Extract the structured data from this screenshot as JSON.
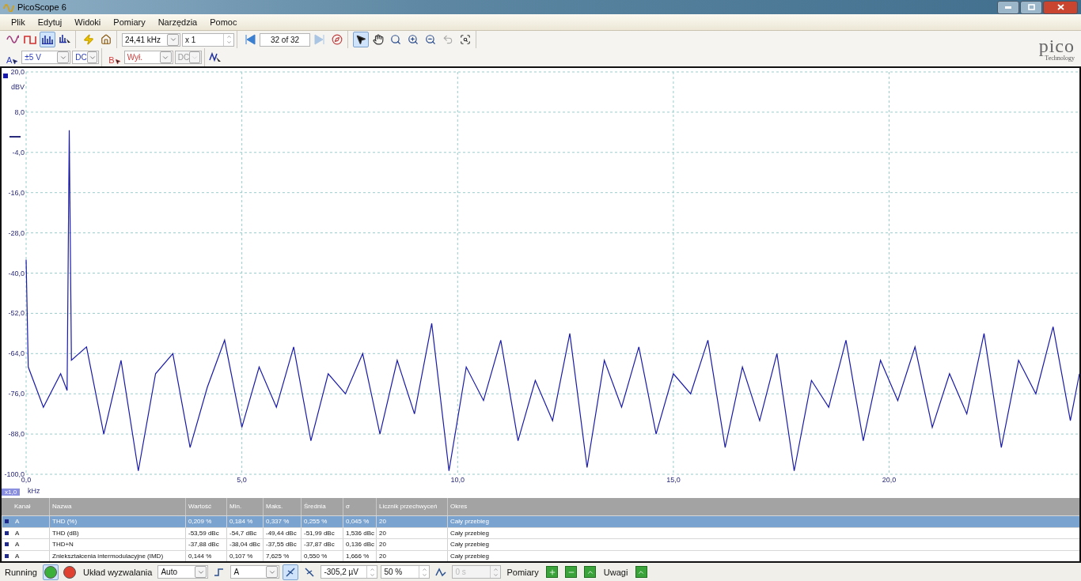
{
  "window": {
    "title": "PicoScope 6"
  },
  "menu": [
    "Plik",
    "Edytuj",
    "Widoki",
    "Pomiary",
    "Narzędzia",
    "Pomoc"
  ],
  "toolbar": {
    "view_modes": [
      {
        "kind": "scope",
        "selected": false
      },
      {
        "kind": "persistence",
        "selected": false
      },
      {
        "kind": "spectrum",
        "selected": true
      },
      {
        "kind": "spectrum-options",
        "selected": false
      }
    ],
    "timebase": "24,41 kHz",
    "multiplier": "x 1",
    "buffer": "32 of 32",
    "tools": [
      {
        "kind": "pointer",
        "selected": true
      },
      {
        "kind": "hand",
        "selected": false
      },
      {
        "kind": "zoom",
        "selected": false
      },
      {
        "kind": "zoom-in",
        "selected": false
      },
      {
        "kind": "zoom-out",
        "selected": false
      },
      {
        "kind": "undo",
        "selected": false
      },
      {
        "kind": "zoom-overview",
        "selected": false
      }
    ]
  },
  "logo": {
    "name": "pico",
    "tagline": "Technology"
  },
  "channels": [
    {
      "letter": "A",
      "range": "±5 V",
      "coupling": "DC",
      "disabled": false,
      "color": "#2b3bbd"
    },
    {
      "letter": "B",
      "range": "Wył.",
      "coupling": "DC",
      "disabled": true,
      "color": "#d04040"
    }
  ],
  "chart": {
    "unit": "dBV",
    "xunit": "kHz",
    "zoom_badge": "x1,0",
    "chart_data": {
      "type": "line",
      "grid": true,
      "xlim": [
        0,
        24.41
      ],
      "ylim": [
        -100,
        20
      ],
      "xticks": [
        {
          "value": 0,
          "label": "0,0"
        },
        {
          "value": 5,
          "label": "5,0"
        },
        {
          "value": 10,
          "label": "10,0"
        },
        {
          "value": 15,
          "label": "15,0"
        },
        {
          "value": 20,
          "label": "20,0"
        }
      ],
      "yticks": [
        {
          "value": 20,
          "label": "20,0"
        },
        {
          "value": 8,
          "label": "8,0"
        },
        {
          "value": -4,
          "label": "-4,0"
        },
        {
          "value": -16,
          "label": "-16,0"
        },
        {
          "value": -28,
          "label": "-28,0"
        },
        {
          "value": -40,
          "label": "-40,0"
        },
        {
          "value": -52,
          "label": "-52,0"
        },
        {
          "value": -64,
          "label": "-64,0"
        },
        {
          "value": -76,
          "label": "-76,0"
        },
        {
          "value": -88,
          "label": "-88,0"
        },
        {
          "value": -100,
          "label": "-100,0"
        }
      ],
      "x": [
        0,
        0.05,
        0.4,
        0.8,
        0.95,
        1.0,
        1.05,
        1.4,
        1.8,
        2.2,
        2.6,
        3.0,
        3.4,
        3.8,
        4.2,
        4.6,
        5.0,
        5.4,
        5.8,
        6.2,
        6.6,
        7.0,
        7.4,
        7.8,
        8.2,
        8.6,
        9.0,
        9.4,
        9.8,
        10.2,
        10.6,
        11.0,
        11.4,
        11.8,
        12.2,
        12.6,
        13.0,
        13.4,
        13.8,
        14.2,
        14.6,
        15.0,
        15.4,
        15.8,
        16.2,
        16.6,
        17.0,
        17.4,
        17.8,
        18.2,
        18.6,
        19.0,
        19.4,
        19.8,
        20.2,
        20.6,
        21.0,
        21.4,
        21.8,
        22.2,
        22.6,
        23.0,
        23.4,
        23.8,
        24.2,
        24.41
      ],
      "series": [
        {
          "color": "#1a1aa8",
          "values": [
            -36,
            -68,
            -80,
            -70,
            -75,
            2.6,
            -66,
            -62,
            -88,
            -66,
            -99,
            -70,
            -64,
            -92,
            -74,
            -60,
            -86,
            -68,
            -80,
            -62,
            -90,
            -70,
            -76,
            -64,
            -88,
            -66,
            -82,
            -55,
            -99,
            -68,
            -78,
            -60,
            -90,
            -72,
            -84,
            -58,
            -98,
            -66,
            -80,
            -62,
            -88,
            -70,
            -76,
            -60,
            -92,
            -68,
            -84,
            -64,
            -99,
            -72,
            -80,
            -60,
            -90,
            -66,
            -78,
            -62,
            -86,
            -70,
            -82,
            -58,
            -92,
            -66,
            -76,
            -56,
            -84,
            -70
          ]
        }
      ]
    }
  },
  "table": {
    "columns": [
      "Kanał",
      "Nazwa",
      "Wartość",
      "Min.",
      "Maks.",
      "Średnia",
      "σ",
      "Licznik przechwyceń",
      "Okres"
    ],
    "rows": [
      {
        "selected": true,
        "cells": [
          "A",
          "THD (%)",
          "0,209 %",
          "0,184 %",
          "0,337 %",
          "0,255 %",
          "0,045 %",
          "20",
          "Cały przebieg"
        ]
      },
      {
        "selected": false,
        "cells": [
          "A",
          "THD (dB)",
          "-53,59 dBc",
          "-54,7 dBc",
          "-49,44 dBc",
          "-51,99 dBc",
          "1,536 dBc",
          "20",
          "Cały przebieg"
        ]
      },
      {
        "selected": false,
        "cells": [
          "A",
          "THD+N",
          "-37,88 dBc",
          "-38,04 dBc",
          "-37,55 dBc",
          "-37,87 dBc",
          "0,136 dBc",
          "20",
          "Cały przebieg"
        ]
      },
      {
        "selected": false,
        "cells": [
          "A",
          "Zniekształcenia intermodulacyjne (IMD)",
          "0,144 %",
          "0,107 %",
          "7,625 %",
          "0,550 %",
          "1,666 %",
          "20",
          "Cały przebieg"
        ]
      }
    ]
  },
  "status_bar": {
    "state": "Running",
    "trigger_label": "Układ wyzwalania",
    "trigger_mode": "Auto",
    "trigger_source": "A",
    "rising_selected": true,
    "threshold": "-305,2 µV",
    "pretrigger": "50 %",
    "delay": "0 s",
    "delay_disabled": true,
    "measurements_label": "Pomiary",
    "notes_label": "Uwagi"
  }
}
